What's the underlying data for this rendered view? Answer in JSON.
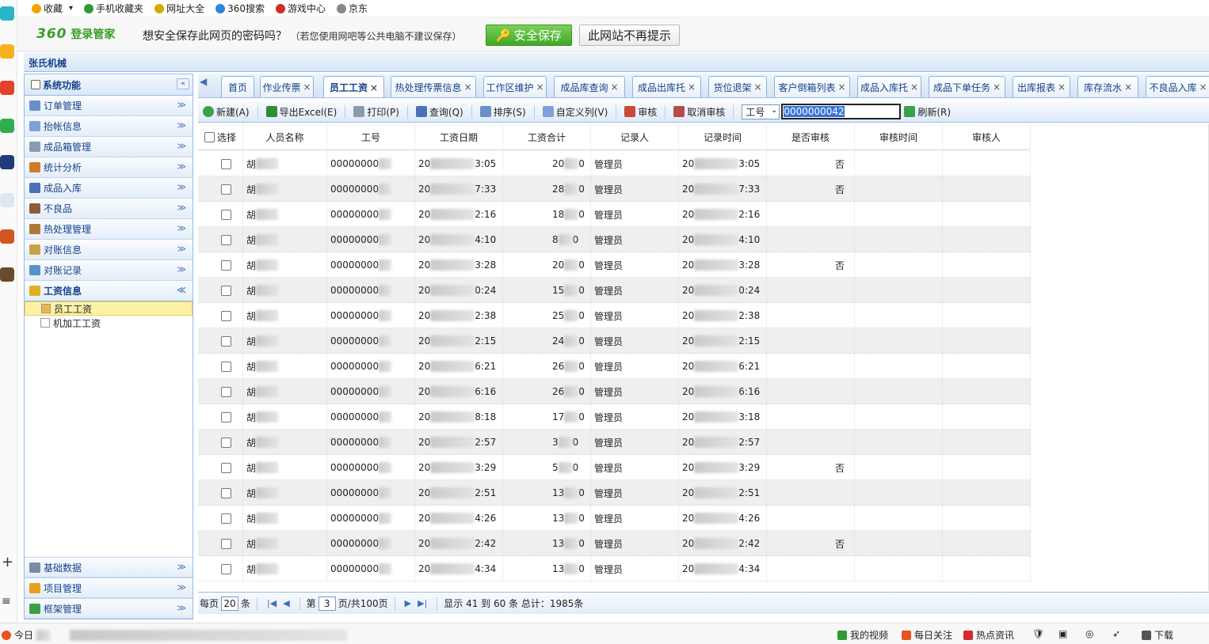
{
  "favorites": [
    {
      "label": "收藏",
      "icon": "star-icon",
      "color": "#f0a400"
    },
    {
      "label": "手机收藏夹",
      "icon": "phone-icon",
      "color": "#2d9a32"
    },
    {
      "label": "网址大全",
      "icon": "plus-globe-icon",
      "color": "#d8a700"
    },
    {
      "label": "360搜索",
      "icon": "search-icon",
      "color": "#2a88d8"
    },
    {
      "label": "游戏中心",
      "icon": "game-icon",
      "color": "#d42b2b"
    },
    {
      "label": "京东",
      "icon": "page-icon",
      "color": "#888888"
    }
  ],
  "password_bar": {
    "brand_num": "360",
    "brand_text": "登录管家",
    "message": "想安全保存此网页的密码吗？",
    "note": "（若您使用网吧等公共电脑不建议保存）",
    "save_label": "安全保存",
    "never_label": "此网站不再提示"
  },
  "app": {
    "title": "张氏机械"
  },
  "nav": {
    "header": "系统功能",
    "collapse_icon": "«",
    "items": [
      {
        "label": "订单管理",
        "color": "#6b8fc8"
      },
      {
        "label": "抬帐信息",
        "color": "#7da1d8"
      },
      {
        "label": "成品箱管理",
        "color": "#8a9ab5"
      },
      {
        "label": "统计分析",
        "color": "#d07a2a"
      },
      {
        "label": "成品入库",
        "color": "#4a72b8"
      },
      {
        "label": "不良品",
        "color": "#8e5c3a"
      },
      {
        "label": "热处理管理",
        "color": "#b07838"
      },
      {
        "label": "对账信息",
        "color": "#c8a24a"
      },
      {
        "label": "对账记录",
        "color": "#5a8fd0"
      }
    ],
    "open_item": {
      "label": "工资信息",
      "color": "#e0b020"
    },
    "sub_items": [
      {
        "label": "员工工资",
        "selected": true
      },
      {
        "label": "机加工工资",
        "selected": false
      }
    ],
    "bottom_items": [
      {
        "label": "基础数据",
        "color": "#7a8aa8"
      },
      {
        "label": "项目管理",
        "color": "#e8a020"
      },
      {
        "label": "框架管理",
        "color": "#3aa04a"
      }
    ],
    "chevron_down": "≫",
    "chevron_up": "≪"
  },
  "tabs": [
    {
      "label": "首页",
      "closable": false
    },
    {
      "label": "作业传票",
      "closable": true
    },
    {
      "label": "员工工资",
      "closable": true,
      "active": true
    },
    {
      "label": "热处理传票信息",
      "closable": true
    },
    {
      "label": "工作区维护",
      "closable": true
    },
    {
      "label": "成品库查询",
      "closable": true
    },
    {
      "label": "成品出库托",
      "closable": true
    },
    {
      "label": "货位退架",
      "closable": true
    },
    {
      "label": "客户倒箱列表",
      "closable": true
    },
    {
      "label": "成品入库托",
      "closable": true
    },
    {
      "label": "成品下单任务",
      "closable": true
    },
    {
      "label": "出库报表",
      "closable": true
    },
    {
      "label": "库存流水",
      "closable": true
    },
    {
      "label": "不良品入库",
      "closable": true
    }
  ],
  "toolbar": {
    "new": "新建(A)",
    "export": "导出Excel(E)",
    "print": "打印(P)",
    "query": "查询(Q)",
    "sort": "排序(S)",
    "custom_cols": "自定义列(V)",
    "audit": "审核",
    "cancel_audit": "取消审核",
    "field_select": "工号",
    "search_value": "0000000042",
    "refresh": "刷新(R)"
  },
  "grid": {
    "select_all": "选择",
    "columns": [
      "人员名称",
      "工号",
      "工资日期",
      "工资合计",
      "记录人",
      "记录时间",
      "是否审核",
      "审核时间",
      "审核人"
    ],
    "rows": [
      {
        "name": "胡",
        "id": "00000000",
        "date": "20",
        "date_end": "3:05",
        "total": "20",
        "total_end": "0",
        "recorder": "管理员",
        "time": "20",
        "time_end": "3:05",
        "audited": "否"
      },
      {
        "name": "胡",
        "id": "00000000",
        "date": "20",
        "date_end": "7:33",
        "total": "28",
        "total_end": "0",
        "recorder": "管理员",
        "time": "20",
        "time_end": "7:33",
        "audited": "否"
      },
      {
        "name": "胡",
        "id": "00000000",
        "date": "20",
        "date_end": "2:16",
        "total": "18",
        "total_end": "0",
        "recorder": "管理员",
        "time": "20",
        "time_end": "2:16",
        "audited": ""
      },
      {
        "name": "胡",
        "id": "00000000",
        "date": "20",
        "date_end": "4:10",
        "total": "8",
        "total_end": "0",
        "recorder": "管理员",
        "time": "20",
        "time_end": "4:10",
        "audited": ""
      },
      {
        "name": "胡",
        "id": "00000000",
        "date": "20",
        "date_end": "3:28",
        "total": "20",
        "total_end": "0",
        "recorder": "管理员",
        "time": "20",
        "time_end": "3:28",
        "audited": "否"
      },
      {
        "name": "胡",
        "id": "00000000",
        "date": "20",
        "date_end": "0:24",
        "total": "15",
        "total_end": "0",
        "recorder": "管理员",
        "time": "20",
        "time_end": "0:24",
        "audited": ""
      },
      {
        "name": "胡",
        "id": "00000000",
        "date": "20",
        "date_end": "2:38",
        "total": "25",
        "total_end": "0",
        "recorder": "管理员",
        "time": "20",
        "time_end": "2:38",
        "audited": ""
      },
      {
        "name": "胡",
        "id": "00000000",
        "date": "20",
        "date_end": "2:15",
        "total": "24",
        "total_end": "0",
        "recorder": "管理员",
        "time": "20",
        "time_end": "2:15",
        "audited": ""
      },
      {
        "name": "胡",
        "id": "00000000",
        "date": "20",
        "date_end": "6:21",
        "total": "26",
        "total_end": "0",
        "recorder": "管理员",
        "time": "20",
        "time_end": "6:21",
        "audited": ""
      },
      {
        "name": "胡",
        "id": "00000000",
        "date": "20",
        "date_end": "6:16",
        "total": "26",
        "total_end": "0",
        "recorder": "管理员",
        "time": "20",
        "time_end": "6:16",
        "audited": ""
      },
      {
        "name": "胡",
        "id": "00000000",
        "date": "20",
        "date_end": "8:18",
        "total": "17",
        "total_end": "0",
        "recorder": "管理员",
        "time": "20",
        "time_end": "3:18",
        "audited": ""
      },
      {
        "name": "胡",
        "id": "00000000",
        "date": "20",
        "date_end": "2:57",
        "total": "3",
        "total_end": "0",
        "recorder": "管理员",
        "time": "20",
        "time_end": "2:57",
        "audited": ""
      },
      {
        "name": "胡",
        "id": "00000000",
        "date": "20",
        "date_end": "3:29",
        "total": "5",
        "total_end": "0",
        "recorder": "管理员",
        "time": "20",
        "time_end": "3:29",
        "audited": "否"
      },
      {
        "name": "胡",
        "id": "00000000",
        "date": "20",
        "date_end": "2:51",
        "total": "13",
        "total_end": "0",
        "recorder": "管理员",
        "time": "20",
        "time_end": "2:51",
        "audited": ""
      },
      {
        "name": "胡",
        "id": "00000000",
        "date": "20",
        "date_end": "4:26",
        "total": "13",
        "total_end": "0",
        "recorder": "管理员",
        "time": "20",
        "time_end": "4:26",
        "audited": ""
      },
      {
        "name": "胡",
        "id": "00000000",
        "date": "20",
        "date_end": "2:42",
        "total": "13",
        "total_end": "0",
        "recorder": "管理员",
        "time": "20",
        "time_end": "2:42",
        "audited": "否"
      },
      {
        "name": "胡",
        "id": "00000000",
        "date": "20",
        "date_end": "4:34",
        "total": "13",
        "total_end": "0",
        "recorder": "管理员",
        "time": "20",
        "time_end": "4:34",
        "audited": ""
      }
    ]
  },
  "pager": {
    "per_page_prefix": "每页",
    "per_page": "20",
    "per_page_suffix": "条",
    "page_prefix": "第",
    "page": "3",
    "page_suffix": "页/共100页",
    "summary": "显示 41 到 60 条 总计：1985条"
  },
  "statusbar": {
    "news": "今日",
    "items": [
      {
        "label": "我的视频",
        "color": "#2d9a32"
      },
      {
        "label": "每日关注",
        "color": "#e8531f"
      },
      {
        "label": "热点资讯",
        "color": "#d42b2b"
      },
      {
        "label": "下载",
        "color": "#555555"
      }
    ]
  },
  "colors": {
    "accent_border": "#99bbe8",
    "header_text": "#15428b",
    "save_green": "#3fa723"
  }
}
